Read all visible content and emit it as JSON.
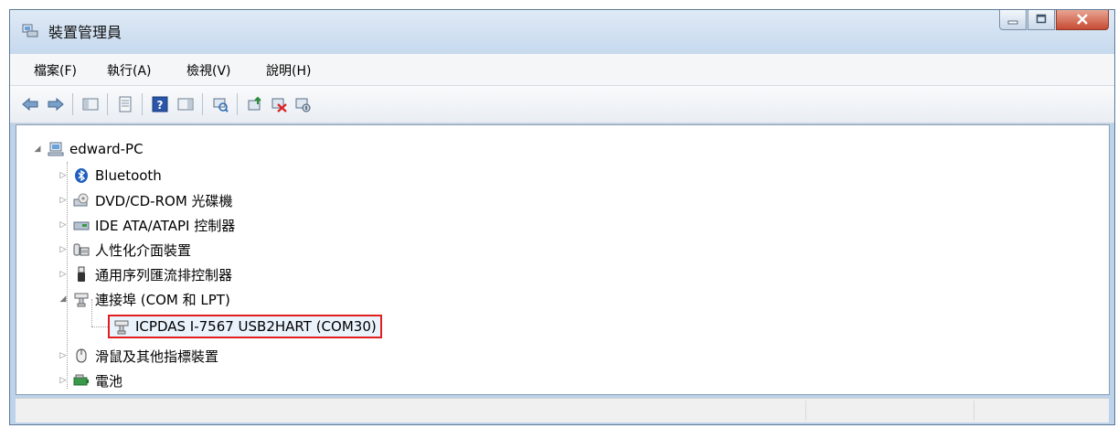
{
  "window": {
    "title": "裝置管理員"
  },
  "menu": [
    {
      "label": "檔案(F)"
    },
    {
      "label": "執行(A)"
    },
    {
      "label": "檢視(V)"
    },
    {
      "label": "說明(H)"
    }
  ],
  "toolbar": {
    "buttons": [
      "back-icon",
      "forward-icon",
      "show-hide-console-tree-icon",
      "properties-icon",
      "help-icon",
      "action-pane-icon",
      "scan-hardware-icon",
      "update-driver-icon",
      "uninstall-icon",
      "disable-icon"
    ]
  },
  "tree": {
    "root": "edward-PC",
    "items": [
      {
        "label": "Bluetooth",
        "icon": "bluetooth-icon"
      },
      {
        "label": "DVD/CD-ROM 光碟機",
        "icon": "dvd-drive-icon"
      },
      {
        "label": "IDE ATA/ATAPI 控制器",
        "icon": "ide-controller-icon"
      },
      {
        "label": "人性化介面裝置",
        "icon": "hid-icon"
      },
      {
        "label": "通用序列匯流排控制器",
        "icon": "usb-icon"
      },
      {
        "label": "連接埠 (COM 和 LPT)",
        "icon": "port-icon"
      },
      {
        "label": "ICPDAS I-7567 USB2HART (COM30)",
        "icon": "port-icon"
      },
      {
        "label": "滑鼠及其他指標裝置",
        "icon": "mouse-icon"
      },
      {
        "label": "電池",
        "icon": "battery-icon"
      }
    ]
  },
  "colors": {
    "selection_border": "#e02020",
    "bluetooth": "#1f5fbf"
  }
}
